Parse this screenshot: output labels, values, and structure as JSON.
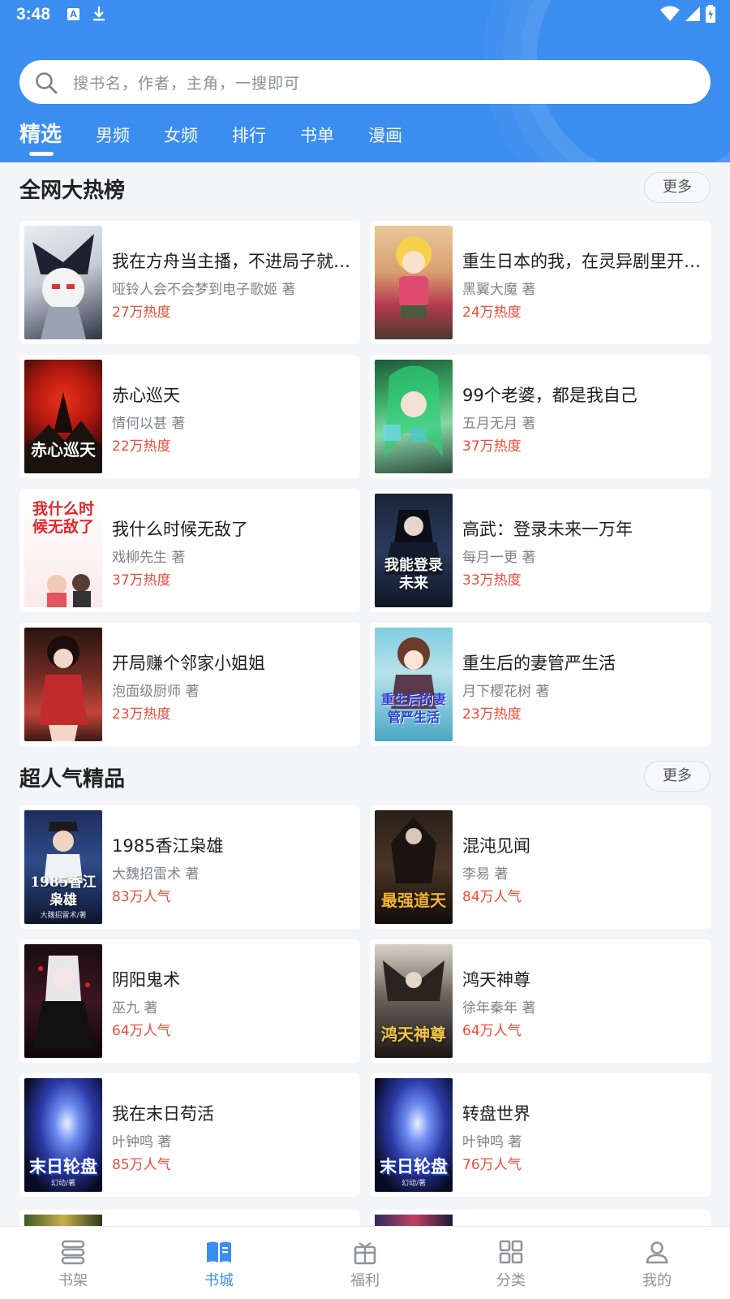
{
  "status_bar": {
    "time": "3:48",
    "a_badge": "A",
    "download_icon": "download-icon",
    "wifi_icon": "wifi-icon",
    "signal_icon": "signal-icon",
    "battery_icon": "battery-icon"
  },
  "search": {
    "placeholder": "搜书名，作者，主角，一搜即可",
    "icon": "search-icon"
  },
  "tabs": [
    {
      "label": "精选",
      "active": true
    },
    {
      "label": "男频"
    },
    {
      "label": "女频"
    },
    {
      "label": "排行"
    },
    {
      "label": "书单"
    },
    {
      "label": "漫画"
    }
  ],
  "sections": [
    {
      "title": "全网大热榜",
      "more": "更多",
      "books": [
        {
          "title": "我在方舟当主播，不进局子就…",
          "author": "哑铃人会不会梦到电子歌姬 著",
          "stat": "27万热度"
        },
        {
          "title": "重生日本的我，在灵异剧里开…",
          "author": "黑翼大魔 著",
          "stat": "24万热度"
        },
        {
          "title": "赤心巡天",
          "author": "情何以甚 著",
          "stat": "22万热度",
          "cover_text": "赤心巡天"
        },
        {
          "title": "99个老婆，都是我自己",
          "author": "五月无月 著",
          "stat": "37万热度"
        },
        {
          "title": "我什么时候无敌了",
          "author": "戏柳先生 著",
          "stat": "37万热度",
          "cover_text": "我什么时候无敌了"
        },
        {
          "title": "高武：登录未来一万年",
          "author": "每月一更 著",
          "stat": "33万热度",
          "cover_text": "我能登录未来"
        },
        {
          "title": "开局赚个邻家小姐姐",
          "author": "泡面级厨师 著",
          "stat": "23万热度"
        },
        {
          "title": "重生后的妻管严生活",
          "author": "月下樱花树 著",
          "stat": "23万热度",
          "cover_text": "重生后的妻管严生活"
        }
      ]
    },
    {
      "title": "超人气精品",
      "more": "更多",
      "books": [
        {
          "title": "1985香江枭雄",
          "author": "大魏招雷术 著",
          "stat": "83万人气",
          "cover_text": "1985香江枭雄",
          "cover_sub": "大魏招雷术/著"
        },
        {
          "title": "混沌见闻",
          "author": "李易 著",
          "stat": "84万人气",
          "cover_text": "最强道天"
        },
        {
          "title": "阴阳鬼术",
          "author": "巫九 著",
          "stat": "64万人气"
        },
        {
          "title": "鸿天神尊",
          "author": "徐年秦年 著",
          "stat": "64万人气",
          "cover_text": "鸿天神尊"
        },
        {
          "title": "我在末日苟活",
          "author": "叶钟鸣 著",
          "stat": "85万人气",
          "cover_text": "末日轮盘",
          "cover_sub": "幻动/著"
        },
        {
          "title": "转盘世界",
          "author": "叶钟鸣 著",
          "stat": "76万人气",
          "cover_text": "末日轮盘",
          "cover_sub": "幻动/著"
        }
      ]
    }
  ],
  "bottom_nav": [
    {
      "label": "书架",
      "icon": "bookshelf-icon"
    },
    {
      "label": "书城",
      "icon": "bookstore-icon",
      "active": true
    },
    {
      "label": "福利",
      "icon": "gift-icon"
    },
    {
      "label": "分类",
      "icon": "category-icon"
    },
    {
      "label": "我的",
      "icon": "profile-icon"
    }
  ],
  "colors": {
    "primary": "#3b8ef0",
    "heat": "#ef4b3a",
    "background": "#f3f5f8"
  }
}
